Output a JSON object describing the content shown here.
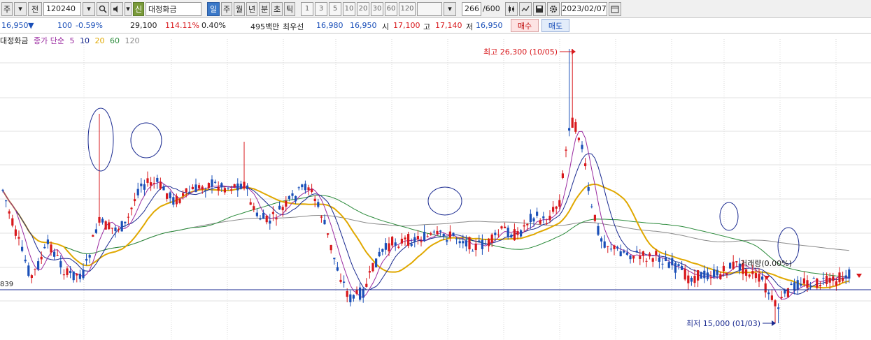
{
  "toolbar": {
    "market": "주",
    "prev": "전",
    "code": "120240",
    "badge": "신",
    "stock_name": "대정화금",
    "periods": [
      "일",
      "주",
      "월",
      "년",
      "분",
      "초",
      "틱"
    ],
    "active_period": "일",
    "intervals": [
      "1",
      "3",
      "5",
      "10",
      "20",
      "30",
      "60",
      "120"
    ],
    "count": "266",
    "count_total": "/600",
    "date": "2023/02/07"
  },
  "info": {
    "price": "16,950",
    "arrow": "▼",
    "change": "100",
    "change_pct": "-0.59%",
    "volume": "29,100",
    "volume_ratio": "114.11%",
    "turnover": "0.40%",
    "amount": "495백만",
    "best_label": "최우선",
    "best_sell": "16,980",
    "best_buy": "16,950",
    "open_label": "시",
    "open": "17,100",
    "high_label": "고",
    "high": "17,140",
    "low_label": "저",
    "low": "16,950",
    "buy_button": "매수",
    "sell_button": "매도"
  },
  "legend": {
    "name": "대정화금",
    "indicator": "종가 단순",
    "ma": [
      "5",
      "10",
      "20",
      "60",
      "120"
    ],
    "ma_colors": [
      "#9a2aa0",
      "#1a2a90",
      "#e0a800",
      "#2a8a3a",
      "#8a8a8a"
    ]
  },
  "annotations": {
    "high_text": "최고 26,300 (10/05)",
    "low_text": "최저 15,000 (01/03)",
    "volume_text": "거래량(0.00%)",
    "price_line": "839"
  },
  "chart_data": {
    "type": "candlestick",
    "high": 26300,
    "high_date": "10/05",
    "low": 15000,
    "low_date": "01/03",
    "last_close": 16950,
    "colors": {
      "up": "#d8181c",
      "down": "#1a4fb8",
      "ma5": "#9a2aa0",
      "ma10": "#1a2a90",
      "ma20": "#e0a800",
      "ma60": "#2a8a3a",
      "ma120": "#8a8a8a"
    }
  }
}
